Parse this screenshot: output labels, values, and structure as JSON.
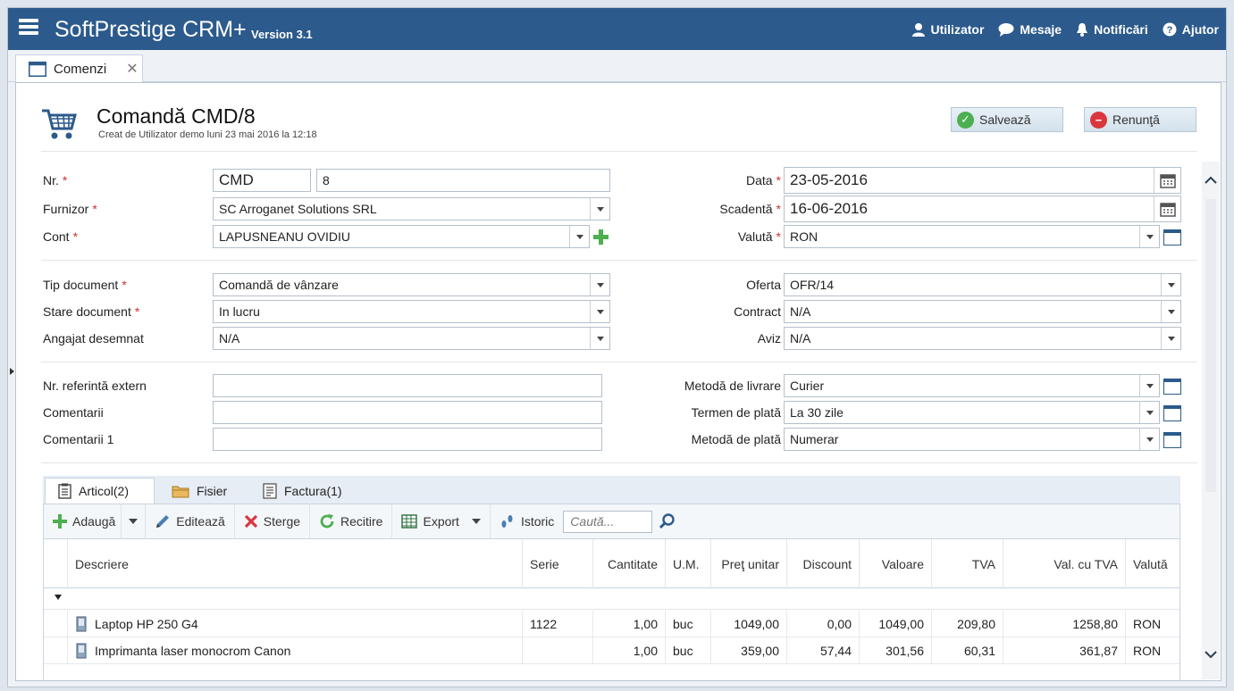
{
  "app": {
    "title": "SoftPrestige CRM+",
    "version": "Version 3.1",
    "actions": [
      {
        "label": "Utilizator",
        "icon": "user-icon"
      },
      {
        "label": "Mesaje",
        "icon": "chat-icon"
      },
      {
        "label": "Notificări",
        "icon": "bell-icon"
      },
      {
        "label": "Ajutor",
        "icon": "help-icon"
      }
    ]
  },
  "tab": {
    "label": "Comenzi",
    "close": "✕"
  },
  "order": {
    "title": "Comandă CMD/8",
    "subtitle": "Creat de Utilizator demo luni 23 mai 2016 la 12:18",
    "save_label": "Salvează",
    "cancel_label": "Renunţă"
  },
  "required_mark": "*",
  "left_fields": {
    "nr": {
      "label": "Nr.",
      "prefix": "CMD",
      "value": "8"
    },
    "furnizor": {
      "label": "Furnizor",
      "value": "SC Arroganet Solutions SRL"
    },
    "cont": {
      "label": "Cont",
      "value": "LAPUSNEANU OVIDIU"
    },
    "tip_document": {
      "label": "Tip document",
      "value": "Comandă de vânzare"
    },
    "stare_document": {
      "label": "Stare document",
      "value": "In lucru"
    },
    "angajat": {
      "label": "Angajat desemnat",
      "value": "N/A"
    },
    "nr_ref": {
      "label": "Nr. referintă extern",
      "value": ""
    },
    "comentarii": {
      "label": "Comentarii",
      "value": ""
    },
    "comentarii1": {
      "label": "Comentarii 1",
      "value": ""
    }
  },
  "right_fields": {
    "data": {
      "label": "Data",
      "value": "23-05-2016"
    },
    "scadenta": {
      "label": "Scadentă",
      "value": "16-06-2016"
    },
    "valuta": {
      "label": "Valută",
      "value": "RON"
    },
    "oferta": {
      "label": "Oferta",
      "value": "OFR/14"
    },
    "contract": {
      "label": "Contract",
      "value": "N/A"
    },
    "aviz": {
      "label": "Aviz",
      "value": "N/A"
    },
    "metoda_livrare": {
      "label": "Metodă de livrare",
      "value": "Curier"
    },
    "termen_plata": {
      "label": "Termen de plată",
      "value": "La 30 zile"
    },
    "metoda_plata": {
      "label": "Metodă de plată",
      "value": "Numerar"
    }
  },
  "inner_tabs": [
    "Articol(2)",
    "Fisier",
    "Factura(1)"
  ],
  "toolbar": {
    "add": "Adaugă",
    "edit": "Editează",
    "delete": "Sterge",
    "recalc": "Recitire",
    "export": "Export",
    "history": "Istoric",
    "search_placeholder": "Caută..."
  },
  "grid": {
    "columns": [
      "Descriere",
      "Serie",
      "Cantitate",
      "U.M.",
      "Preţ unitar",
      "Discount",
      "Valoare",
      "TVA",
      "Val. cu TVA",
      "Valută"
    ],
    "rows": [
      [
        "Laptop HP 250 G4",
        "1122",
        "1,00",
        "buc",
        "1049,00",
        "0,00",
        "1049,00",
        "209,80",
        "1258,80",
        "RON"
      ],
      [
        "Imprimanta laser monocrom Canon",
        "",
        "1,00",
        "buc",
        "359,00",
        "57,44",
        "301,56",
        "60,31",
        "361,87",
        "RON"
      ]
    ]
  },
  "colors": {
    "topbar": "#2c5a8c",
    "accent_green": "#4caf50",
    "accent_red": "#d9363e",
    "required": "#d32f2f"
  }
}
